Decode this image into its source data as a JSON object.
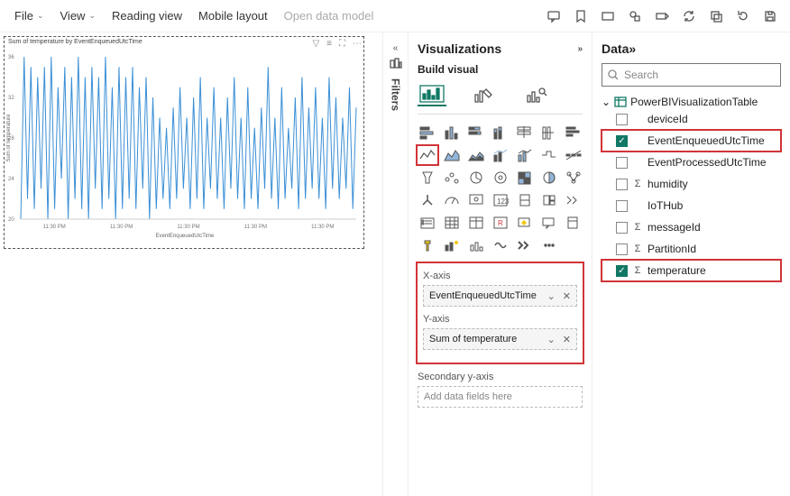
{
  "toolbar": {
    "file": "File",
    "view": "View",
    "reading": "Reading view",
    "mobile": "Mobile layout",
    "open_model": "Open data model"
  },
  "filters": {
    "label": "Filters"
  },
  "viz": {
    "title": "Visualizations",
    "build": "Build visual",
    "xaxis_label": "X-axis",
    "xaxis_field": "EventEnqueuedUtcTime",
    "yaxis_label": "Y-axis",
    "yaxis_field": "Sum of temperature",
    "secondary_label": "Secondary y-axis",
    "secondary_placeholder": "Add data fields here"
  },
  "chart": {
    "title": "Sum of temperature by EventEnqueuedUtcTime",
    "xaxis_label": "EventEnqueuedUtcTime",
    "yaxis_label": "Sum of temperature",
    "x_ticks": [
      "11:30 PM",
      "11:30 PM",
      "11:30 PM",
      "11:30 PM",
      "11:30 PM"
    ]
  },
  "data": {
    "title": "Data",
    "search_placeholder": "Search",
    "table": "PowerBIVisualizationTable",
    "fields": [
      {
        "name": "deviceId",
        "checked": false,
        "sigma": false,
        "hl": false
      },
      {
        "name": "EventEnqueuedUtcTime",
        "checked": true,
        "sigma": false,
        "hl": true
      },
      {
        "name": "EventProcessedUtcTime",
        "checked": false,
        "sigma": false,
        "hl": false
      },
      {
        "name": "humidity",
        "checked": false,
        "sigma": true,
        "hl": false
      },
      {
        "name": "IoTHub",
        "checked": false,
        "sigma": false,
        "hl": false
      },
      {
        "name": "messageId",
        "checked": false,
        "sigma": true,
        "hl": false
      },
      {
        "name": "PartitionId",
        "checked": false,
        "sigma": true,
        "hl": false
      },
      {
        "name": "temperature",
        "checked": true,
        "sigma": true,
        "hl": true
      }
    ]
  },
  "chart_data": {
    "type": "line",
    "title": "Sum of temperature by EventEnqueuedUtcTime",
    "xlabel": "EventEnqueuedUtcTime",
    "ylabel": "Sum of temperature",
    "ylim": [
      20,
      36
    ],
    "x": [
      0,
      1,
      2,
      3,
      4,
      5,
      6,
      7,
      8,
      9,
      10,
      11,
      12,
      13,
      14,
      15,
      16,
      17,
      18,
      19,
      20,
      21,
      22,
      23,
      24,
      25,
      26,
      27,
      28,
      29,
      30,
      31,
      32,
      33,
      34,
      35,
      36,
      37,
      38,
      39,
      40,
      41,
      42,
      43,
      44,
      45,
      46,
      47,
      48,
      49,
      50,
      51,
      52,
      53,
      54,
      55,
      56,
      57,
      58,
      59,
      60,
      61,
      62,
      63,
      64,
      65,
      66,
      67,
      68,
      69,
      70,
      71,
      72,
      73,
      74,
      75,
      76,
      77,
      78,
      79,
      80,
      81,
      82,
      83,
      84,
      85,
      86,
      87,
      88,
      89,
      90,
      91,
      92,
      93,
      94,
      95,
      96,
      97,
      98,
      99
    ],
    "values": [
      20,
      36,
      22,
      35,
      21,
      34,
      23,
      35,
      20,
      36,
      21,
      33,
      24,
      35,
      20,
      34,
      22,
      36,
      21,
      34,
      20,
      35,
      23,
      34,
      21,
      36,
      22,
      33,
      20,
      35,
      21,
      34,
      22,
      35,
      21,
      33,
      23,
      34,
      20,
      32,
      21,
      30,
      22,
      29,
      21,
      31,
      22,
      33,
      23,
      30,
      21,
      32,
      22,
      34,
      21,
      30,
      23,
      33,
      22,
      30,
      21,
      32,
      23,
      34,
      22,
      30,
      21,
      33,
      22,
      29,
      21,
      31,
      23,
      35,
      22,
      30,
      21,
      33,
      22,
      29,
      23,
      32,
      21,
      34,
      22,
      31,
      23,
      33,
      22,
      30,
      21,
      34,
      23,
      32,
      22,
      30,
      23,
      33,
      21,
      31
    ]
  }
}
